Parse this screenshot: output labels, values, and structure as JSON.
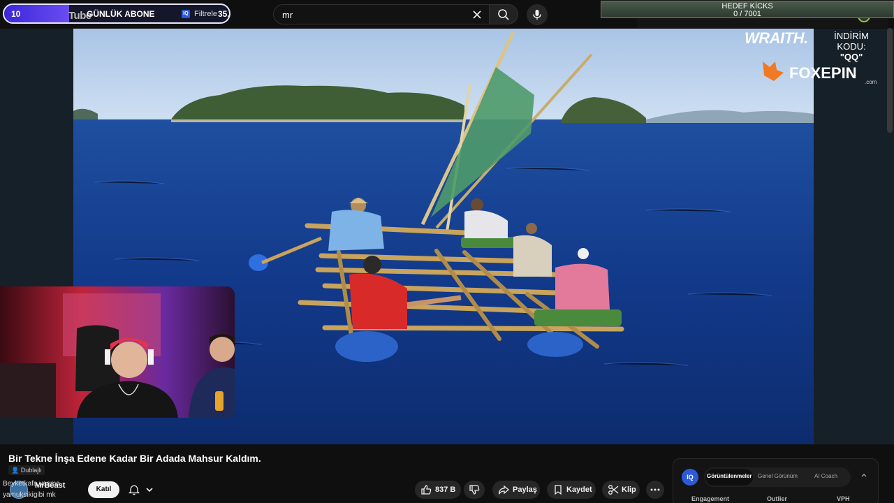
{
  "goal": {
    "current": "10",
    "yt_word": "Tube",
    "label": "GÜNLÜK ABONE",
    "filter_icon_text": "IQ",
    "filter_label": "Filtrele",
    "target": "35.",
    "progress_fraction": 0.29
  },
  "search": {
    "query": "mr"
  },
  "kicks": {
    "title": "HEDEF KİCKS",
    "count": "0 / 7001"
  },
  "sponsor": {
    "wraith": "WRAITH.",
    "discount_label": "İNDİRİM KODU:",
    "discount_code": "\"QQ\"",
    "foxepin": "FOXEPIN",
    "foxepin_sub": ".com"
  },
  "video": {
    "title": "Bir Tekne İnşa Edene Kadar Bir Adada Mahsur Kaldım.",
    "dub_label": "Dublajlı"
  },
  "channel": {
    "overlay_line1": "Beyketkafa yaşma",
    "overlay_line2": "yamuksikigibi mk",
    "name": "MrBeast",
    "join_label": "Katıl"
  },
  "actions": {
    "likes": "837 B",
    "share": "Paylaş",
    "save": "Kaydet",
    "clip": "Klip"
  },
  "iq_panel": {
    "logo": "IQ",
    "tabs": [
      "Görüntülenmeler",
      "Genel Görünüm",
      "AI Coach"
    ],
    "columns": [
      "Engagement",
      "Outlier",
      "VPH"
    ]
  },
  "colors": {
    "accent_goal": "#3b28d8",
    "iq_blue": "#2c5ad8",
    "kicks_green": "#4a5a4a"
  }
}
